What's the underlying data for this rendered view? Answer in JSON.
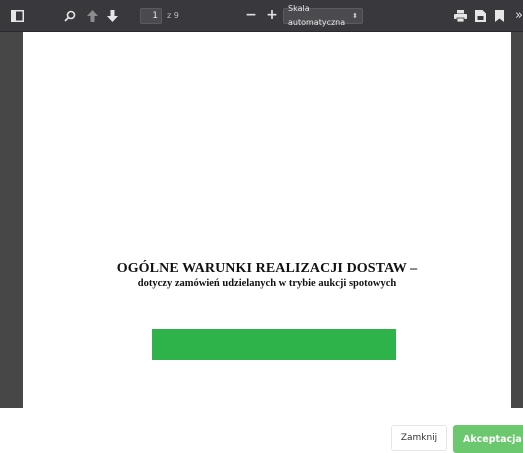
{
  "toolbar": {
    "sidebar_toggle_icon": "sidebar-toggle-icon",
    "search_icon": "search-icon",
    "prev_page_icon": "arrow-up-icon",
    "next_page_icon": "arrow-down-icon",
    "page_number": "1",
    "page_total": "z 9",
    "zoom_out_label": "−",
    "zoom_in_label": "+",
    "zoom_value": "Skala automatyczna",
    "print_icon": "print-icon",
    "save_icon": "download-icon",
    "bookmark_icon": "bookmark-icon",
    "more_label": "»"
  },
  "document": {
    "title": "OGÓLNE WARUNKI REALIZACJI DOSTAW –",
    "subtitle": "dotyczy zamówień udzielanych w trybie aukcji spotowych",
    "highlight_color": "#2db34a"
  },
  "footer": {
    "close_label": "Zamknij",
    "accept_label": "Akceptacja",
    "accept_color": "#6cc86e"
  }
}
